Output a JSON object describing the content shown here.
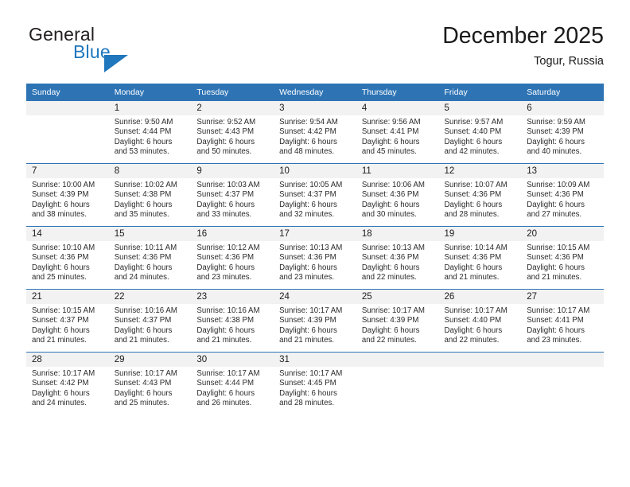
{
  "brand": {
    "name_part1": "General",
    "name_part2": "Blue",
    "accent_color": "#1f77bd"
  },
  "header": {
    "title": "December 2025",
    "subtitle": "Togur, Russia"
  },
  "theme": {
    "header_blue": "#2e74b5",
    "daynum_band": "#f2f2f2",
    "text": "#1a1a1a"
  },
  "weekday_headers": [
    "Sunday",
    "Monday",
    "Tuesday",
    "Wednesday",
    "Thursday",
    "Friday",
    "Saturday"
  ],
  "weeks": [
    [
      {
        "day": "",
        "sunrise": "",
        "sunset": "",
        "daylight_line1": "",
        "daylight_line2": ""
      },
      {
        "day": "1",
        "sunrise": "Sunrise: 9:50 AM",
        "sunset": "Sunset: 4:44 PM",
        "daylight_line1": "Daylight: 6 hours",
        "daylight_line2": "and 53 minutes."
      },
      {
        "day": "2",
        "sunrise": "Sunrise: 9:52 AM",
        "sunset": "Sunset: 4:43 PM",
        "daylight_line1": "Daylight: 6 hours",
        "daylight_line2": "and 50 minutes."
      },
      {
        "day": "3",
        "sunrise": "Sunrise: 9:54 AM",
        "sunset": "Sunset: 4:42 PM",
        "daylight_line1": "Daylight: 6 hours",
        "daylight_line2": "and 48 minutes."
      },
      {
        "day": "4",
        "sunrise": "Sunrise: 9:56 AM",
        "sunset": "Sunset: 4:41 PM",
        "daylight_line1": "Daylight: 6 hours",
        "daylight_line2": "and 45 minutes."
      },
      {
        "day": "5",
        "sunrise": "Sunrise: 9:57 AM",
        "sunset": "Sunset: 4:40 PM",
        "daylight_line1": "Daylight: 6 hours",
        "daylight_line2": "and 42 minutes."
      },
      {
        "day": "6",
        "sunrise": "Sunrise: 9:59 AM",
        "sunset": "Sunset: 4:39 PM",
        "daylight_line1": "Daylight: 6 hours",
        "daylight_line2": "and 40 minutes."
      }
    ],
    [
      {
        "day": "7",
        "sunrise": "Sunrise: 10:00 AM",
        "sunset": "Sunset: 4:39 PM",
        "daylight_line1": "Daylight: 6 hours",
        "daylight_line2": "and 38 minutes."
      },
      {
        "day": "8",
        "sunrise": "Sunrise: 10:02 AM",
        "sunset": "Sunset: 4:38 PM",
        "daylight_line1": "Daylight: 6 hours",
        "daylight_line2": "and 35 minutes."
      },
      {
        "day": "9",
        "sunrise": "Sunrise: 10:03 AM",
        "sunset": "Sunset: 4:37 PM",
        "daylight_line1": "Daylight: 6 hours",
        "daylight_line2": "and 33 minutes."
      },
      {
        "day": "10",
        "sunrise": "Sunrise: 10:05 AM",
        "sunset": "Sunset: 4:37 PM",
        "daylight_line1": "Daylight: 6 hours",
        "daylight_line2": "and 32 minutes."
      },
      {
        "day": "11",
        "sunrise": "Sunrise: 10:06 AM",
        "sunset": "Sunset: 4:36 PM",
        "daylight_line1": "Daylight: 6 hours",
        "daylight_line2": "and 30 minutes."
      },
      {
        "day": "12",
        "sunrise": "Sunrise: 10:07 AM",
        "sunset": "Sunset: 4:36 PM",
        "daylight_line1": "Daylight: 6 hours",
        "daylight_line2": "and 28 minutes."
      },
      {
        "day": "13",
        "sunrise": "Sunrise: 10:09 AM",
        "sunset": "Sunset: 4:36 PM",
        "daylight_line1": "Daylight: 6 hours",
        "daylight_line2": "and 27 minutes."
      }
    ],
    [
      {
        "day": "14",
        "sunrise": "Sunrise: 10:10 AM",
        "sunset": "Sunset: 4:36 PM",
        "daylight_line1": "Daylight: 6 hours",
        "daylight_line2": "and 25 minutes."
      },
      {
        "day": "15",
        "sunrise": "Sunrise: 10:11 AM",
        "sunset": "Sunset: 4:36 PM",
        "daylight_line1": "Daylight: 6 hours",
        "daylight_line2": "and 24 minutes."
      },
      {
        "day": "16",
        "sunrise": "Sunrise: 10:12 AM",
        "sunset": "Sunset: 4:36 PM",
        "daylight_line1": "Daylight: 6 hours",
        "daylight_line2": "and 23 minutes."
      },
      {
        "day": "17",
        "sunrise": "Sunrise: 10:13 AM",
        "sunset": "Sunset: 4:36 PM",
        "daylight_line1": "Daylight: 6 hours",
        "daylight_line2": "and 23 minutes."
      },
      {
        "day": "18",
        "sunrise": "Sunrise: 10:13 AM",
        "sunset": "Sunset: 4:36 PM",
        "daylight_line1": "Daylight: 6 hours",
        "daylight_line2": "and 22 minutes."
      },
      {
        "day": "19",
        "sunrise": "Sunrise: 10:14 AM",
        "sunset": "Sunset: 4:36 PM",
        "daylight_line1": "Daylight: 6 hours",
        "daylight_line2": "and 21 minutes."
      },
      {
        "day": "20",
        "sunrise": "Sunrise: 10:15 AM",
        "sunset": "Sunset: 4:36 PM",
        "daylight_line1": "Daylight: 6 hours",
        "daylight_line2": "and 21 minutes."
      }
    ],
    [
      {
        "day": "21",
        "sunrise": "Sunrise: 10:15 AM",
        "sunset": "Sunset: 4:37 PM",
        "daylight_line1": "Daylight: 6 hours",
        "daylight_line2": "and 21 minutes."
      },
      {
        "day": "22",
        "sunrise": "Sunrise: 10:16 AM",
        "sunset": "Sunset: 4:37 PM",
        "daylight_line1": "Daylight: 6 hours",
        "daylight_line2": "and 21 minutes."
      },
      {
        "day": "23",
        "sunrise": "Sunrise: 10:16 AM",
        "sunset": "Sunset: 4:38 PM",
        "daylight_line1": "Daylight: 6 hours",
        "daylight_line2": "and 21 minutes."
      },
      {
        "day": "24",
        "sunrise": "Sunrise: 10:17 AM",
        "sunset": "Sunset: 4:39 PM",
        "daylight_line1": "Daylight: 6 hours",
        "daylight_line2": "and 21 minutes."
      },
      {
        "day": "25",
        "sunrise": "Sunrise: 10:17 AM",
        "sunset": "Sunset: 4:39 PM",
        "daylight_line1": "Daylight: 6 hours",
        "daylight_line2": "and 22 minutes."
      },
      {
        "day": "26",
        "sunrise": "Sunrise: 10:17 AM",
        "sunset": "Sunset: 4:40 PM",
        "daylight_line1": "Daylight: 6 hours",
        "daylight_line2": "and 22 minutes."
      },
      {
        "day": "27",
        "sunrise": "Sunrise: 10:17 AM",
        "sunset": "Sunset: 4:41 PM",
        "daylight_line1": "Daylight: 6 hours",
        "daylight_line2": "and 23 minutes."
      }
    ],
    [
      {
        "day": "28",
        "sunrise": "Sunrise: 10:17 AM",
        "sunset": "Sunset: 4:42 PM",
        "daylight_line1": "Daylight: 6 hours",
        "daylight_line2": "and 24 minutes."
      },
      {
        "day": "29",
        "sunrise": "Sunrise: 10:17 AM",
        "sunset": "Sunset: 4:43 PM",
        "daylight_line1": "Daylight: 6 hours",
        "daylight_line2": "and 25 minutes."
      },
      {
        "day": "30",
        "sunrise": "Sunrise: 10:17 AM",
        "sunset": "Sunset: 4:44 PM",
        "daylight_line1": "Daylight: 6 hours",
        "daylight_line2": "and 26 minutes."
      },
      {
        "day": "31",
        "sunrise": "Sunrise: 10:17 AM",
        "sunset": "Sunset: 4:45 PM",
        "daylight_line1": "Daylight: 6 hours",
        "daylight_line2": "and 28 minutes."
      },
      {
        "day": "",
        "sunrise": "",
        "sunset": "",
        "daylight_line1": "",
        "daylight_line2": ""
      },
      {
        "day": "",
        "sunrise": "",
        "sunset": "",
        "daylight_line1": "",
        "daylight_line2": ""
      },
      {
        "day": "",
        "sunrise": "",
        "sunset": "",
        "daylight_line1": "",
        "daylight_line2": ""
      }
    ]
  ]
}
